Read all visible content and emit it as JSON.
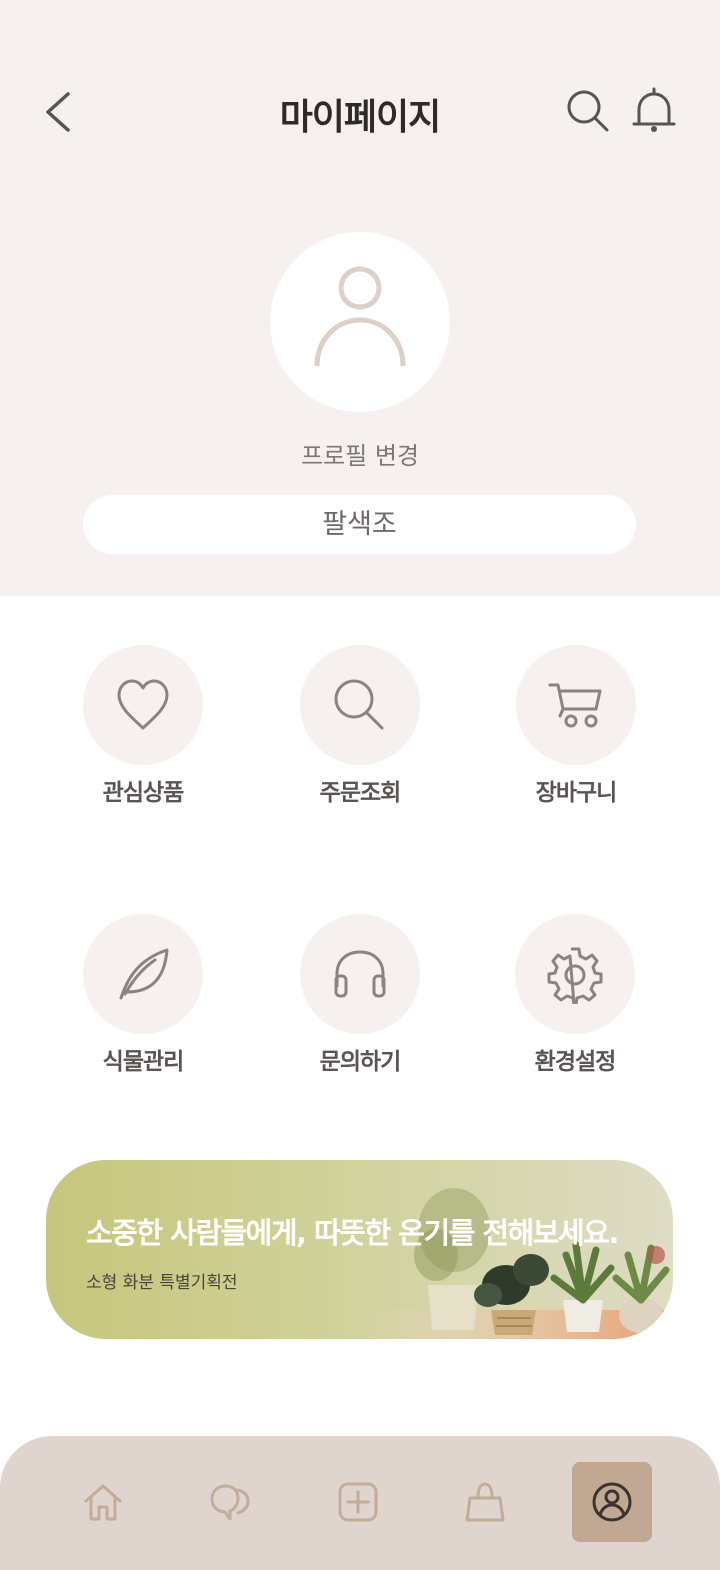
{
  "header": {
    "title": "마이페이지",
    "back_icon": "chevron-left-icon",
    "search_icon": "search-icon",
    "notification_icon": "bell-icon"
  },
  "profile": {
    "avatar_icon": "user-icon",
    "change_label": "프로필 변경",
    "nickname": "팔색조"
  },
  "menu": {
    "items": [
      {
        "label": "관심상품",
        "icon": "heart-icon"
      },
      {
        "label": "주문조회",
        "icon": "search-icon"
      },
      {
        "label": "장바구니",
        "icon": "cart-icon"
      },
      {
        "label": "식물관리",
        "icon": "leaf-icon"
      },
      {
        "label": "문의하기",
        "icon": "headphones-icon"
      },
      {
        "label": "환경설정",
        "icon": "gear-icon"
      }
    ]
  },
  "banner": {
    "title": "소중한 사람들에게, 따뜻한 온기를 전해보세요.",
    "subtitle": "소형 화분 특별기획전"
  },
  "bottom_nav": {
    "items": [
      "home-icon",
      "chat-icon",
      "add-icon",
      "shopping-bag-icon",
      "profile-icon"
    ],
    "active": "profile-icon"
  },
  "colors": {
    "top_background": "#f6f1ee",
    "icon_gray": "#8a8481",
    "nav_background": "#e0d4ce",
    "nav_icon": "#c3ac98",
    "nav_active": "#c0a892"
  }
}
